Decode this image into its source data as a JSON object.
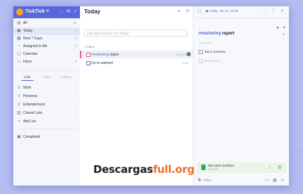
{
  "app": {
    "title": "TickTick"
  },
  "sidebar": {
    "items": [
      {
        "label": "All",
        "count": "11",
        "icon": "inbox-stack-icon"
      },
      {
        "label": "Today",
        "count": "2",
        "icon": "today-calendar-icon"
      },
      {
        "label": "Next 7 Days",
        "count": "6",
        "icon": "week-calendar-icon"
      },
      {
        "label": "Assigned to Me",
        "count": "2",
        "icon": "person-icon"
      },
      {
        "label": "Calendar",
        "count": "",
        "icon": "calendar-icon"
      },
      {
        "label": "Inbox",
        "count": "3",
        "icon": "inbox-icon"
      }
    ],
    "tabs": [
      "Lists",
      "Tags",
      "Custom"
    ],
    "lists": [
      {
        "label": "Work",
        "icon": "list-icon"
      },
      {
        "label": "Personal",
        "icon": "list-icon"
      },
      {
        "label": "Entertainment",
        "icon": "list-icon"
      },
      {
        "label": "Closed Lists",
        "icon": "archive-icon"
      }
    ],
    "add_list": "Add List",
    "completed": "Completed"
  },
  "main": {
    "title": "Today",
    "add_placeholder": "Add Task to\"Inbox\" on \"Today\"",
    "section": "Inbox",
    "tasks": [
      {
        "tag": "#marketing",
        "text": " report",
        "meta": "1",
        "date": "16:00"
      },
      {
        "text": "Go to walmart",
        "date": "10:00"
      }
    ]
  },
  "detail": {
    "date": "Today, Jan 11, 16:00",
    "title_tag": "#marketing",
    "title_rest": " report",
    "subtitle": "Description",
    "checklist": [
      "Top 5 countries",
      "Rival prices"
    ],
    "attachment": {
      "name": "My notes numbers",
      "size": "1.60 KB"
    },
    "list_name": "Office"
  },
  "watermark": {
    "part1": "Descargas",
    "part2": "full.org"
  },
  "colors": {
    "accent": "#5867dd",
    "background": "#b3bdf2",
    "tag": "#e35e8f"
  }
}
